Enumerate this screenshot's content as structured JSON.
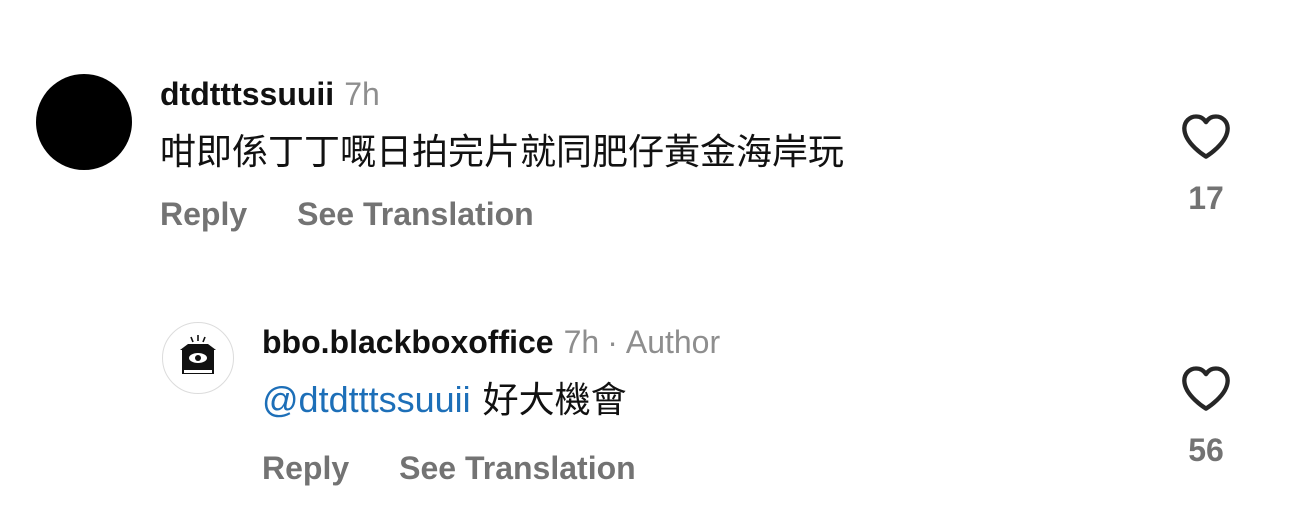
{
  "comments": [
    {
      "username": "dtdtttssuuii",
      "time": "7h",
      "text": "咁即係丁丁嘅日拍完片就同肥仔黃金海岸玩",
      "reply_label": "Reply",
      "translate_label": "See Translation",
      "likes": "17",
      "avatar_icon": "black-circle-avatar",
      "like_icon": "heart-outline-icon"
    },
    {
      "username": "bbo.blackboxoffice",
      "time": "7h",
      "separator": "·",
      "badge": "Author",
      "mention": "@dtdtttssuuii",
      "text": "好大機會",
      "reply_label": "Reply",
      "translate_label": "See Translation",
      "likes": "56",
      "avatar_icon": "black-box-office-logo",
      "like_icon": "heart-outline-icon"
    }
  ],
  "colors": {
    "text": "#111111",
    "muted": "#737373",
    "timestamp": "#8e8e8e",
    "mention": "#1d6fb8",
    "background": "#ffffff"
  }
}
